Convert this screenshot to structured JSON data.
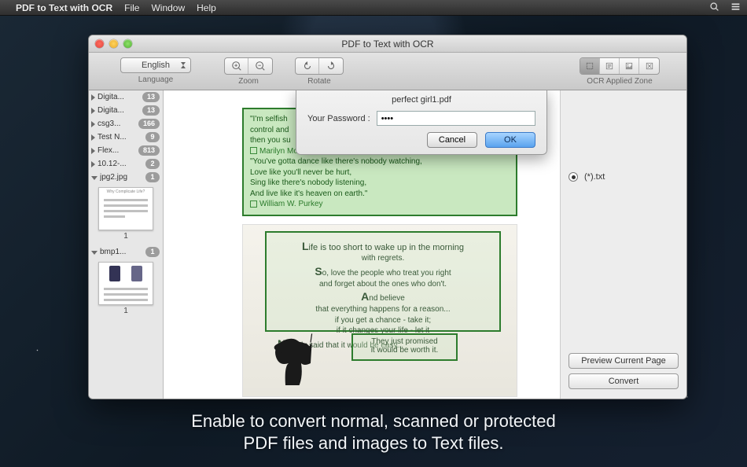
{
  "menubar": {
    "app": "PDF to Text with OCR",
    "items": [
      "File",
      "Window",
      "Help"
    ]
  },
  "window": {
    "title": "PDF to Text with OCR"
  },
  "toolbar": {
    "language": {
      "label": "Language",
      "value": "English"
    },
    "zoom": {
      "label": "Zoom"
    },
    "rotate": {
      "label": "Rotate"
    },
    "ocrzone": {
      "label": "OCR Applied Zone"
    }
  },
  "sidebar": {
    "items": [
      {
        "name": "Digita...",
        "badge": "13",
        "expanded": false
      },
      {
        "name": "Digita...",
        "badge": "13",
        "expanded": false
      },
      {
        "name": "csg3...",
        "badge": "166",
        "expanded": false
      },
      {
        "name": "Test N...",
        "badge": "9",
        "expanded": false
      },
      {
        "name": "Flex...",
        "badge": "813",
        "expanded": false
      },
      {
        "name": "10.12-...",
        "badge": "2",
        "expanded": false
      },
      {
        "name": "jpg2.jpg",
        "badge": "1",
        "expanded": true,
        "thumb_caption": "Why Complicate Life?",
        "page": "1"
      },
      {
        "name": "bmp1...",
        "badge": "1",
        "expanded": true,
        "page": "1"
      }
    ]
  },
  "canvas": {
    "quote1": {
      "l1": "\"I'm selfish",
      "l2": "control and",
      "l3": "then you su",
      "author1": "Marilyn Monroe",
      "l4": "\"You've gotta dance like there's nobody watching,",
      "l5": "Love like you'll never be hurt,",
      "l6": "Sing like there's nobody listening,",
      "l7": "And live like it's heaven on earth.\"",
      "author2": "William W. Purkey"
    },
    "quote2": {
      "l1": "Life is too short to wake up in the morning",
      "l2": "with regrets.",
      "l3": "So, love the people who treat you right",
      "l4": "and forget about the ones who don't.",
      "l5": "And believe",
      "l6": "that everything happens for a reason...",
      "l7": "if you get a chance - take it;",
      "l8": "if it changes your life - let it",
      "l9": "Nobody said that it would be easy..."
    },
    "quote3": {
      "l1": "They just promised",
      "l2": "it would be worth it."
    }
  },
  "rightpanel": {
    "format": "(*).txt",
    "preview": "Preview Current Page",
    "convert": "Convert"
  },
  "dialog": {
    "title": "perfect girl1.pdf",
    "label": "Your Password :",
    "value": "••••",
    "cancel": "Cancel",
    "ok": "OK"
  },
  "tagline": {
    "l1": "Enable to convert normal, scanned or protected",
    "l2": "PDF files and images to Text files."
  }
}
